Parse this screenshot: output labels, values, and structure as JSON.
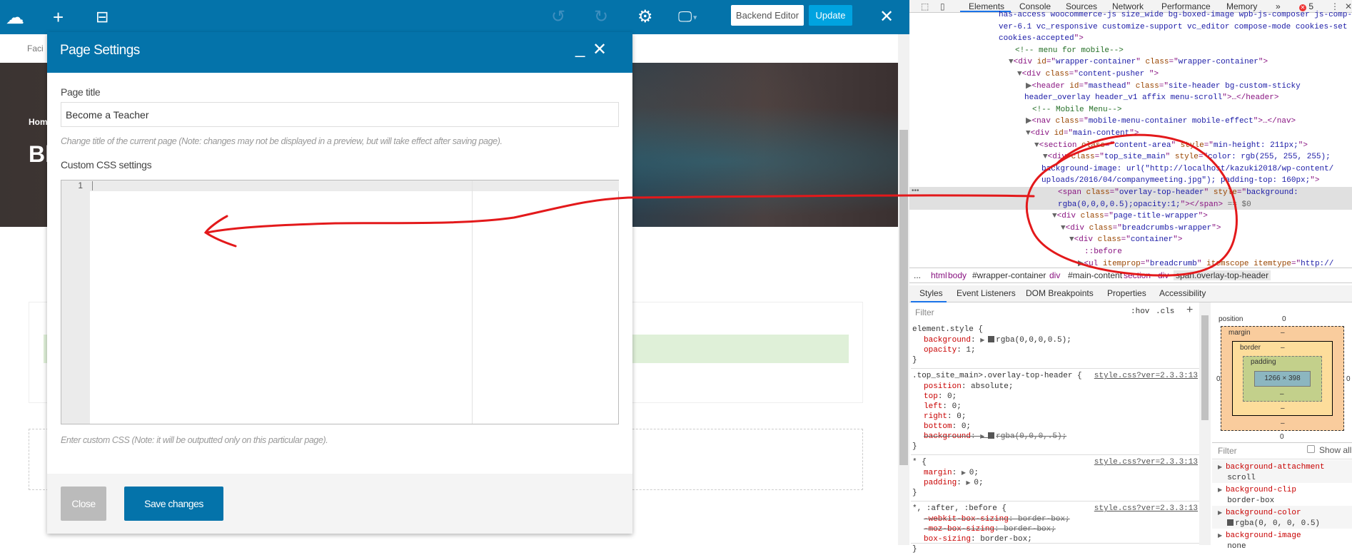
{
  "toolbar": {
    "icons": {
      "logo": "cloud-logo-icon",
      "add": "plus-icon",
      "templates": "layout-icon",
      "undo": "undo-icon",
      "redo": "redo-icon",
      "settings": "gear-icon",
      "responsive": "monitor-icon",
      "close": "close-icon"
    },
    "backend_editor": "Backend Editor",
    "update": "Update",
    "accent": "#0473aa",
    "update_color": "#00a3e0"
  },
  "page": {
    "subheader_text": "Faci",
    "breadcrumb_text": "Hom",
    "hero_title_text": "Bl"
  },
  "modal": {
    "title": "Page Settings",
    "minimize": "_",
    "close": "✕",
    "page_title_label": "Page title",
    "page_title_value": "Become a Teacher",
    "page_title_help": "Change title of the current page (Note: changes may not be displayed in a preview, but will take effect after saving page).",
    "css_label": "Custom CSS settings",
    "css_line_number": "1",
    "css_help": "Enter custom CSS (Note: it will be outputted only on this particular page).",
    "close_button": "Close",
    "save_button": "Save changes"
  },
  "devtools": {
    "tabs": [
      "Elements",
      "Console",
      "Sources",
      "Network",
      "Performance",
      "Memory",
      "»"
    ],
    "active_tab": "Elements",
    "error_count": "5",
    "dom_lines": [
      [
        [
          "v",
          "has-access woocommerce-js size_wide bg-boxed-image wpb-js-composer js-comp-"
        ]
      ],
      [
        [
          "v",
          "ver-6.1 vc_responsive customize-support vc_editor compose-mode cookies-set"
        ]
      ],
      [
        [
          "v",
          "cookies-accepted"
        ],
        [
          "t",
          "\">"
        ]
      ],
      [
        [
          "c",
          "<!-- menu for mobile-->"
        ]
      ],
      [
        [
          "g",
          "▼"
        ],
        [
          "t",
          "<div "
        ],
        [
          "a",
          "id"
        ],
        [
          "t",
          "=\""
        ],
        [
          "v",
          "wrapper-container"
        ],
        [
          "t",
          "\" "
        ],
        [
          "a",
          "class"
        ],
        [
          "t",
          "=\""
        ],
        [
          "v",
          "wrapper-container"
        ],
        [
          "t",
          "\">"
        ]
      ],
      [
        [
          "g",
          "▼"
        ],
        [
          "t",
          "<div "
        ],
        [
          "a",
          "class"
        ],
        [
          "t",
          "=\""
        ],
        [
          "v",
          "content-pusher "
        ],
        [
          "t",
          "\">"
        ]
      ],
      [
        [
          "g",
          "▶"
        ],
        [
          "t",
          "<header "
        ],
        [
          "a",
          "id"
        ],
        [
          "t",
          "=\""
        ],
        [
          "v",
          "masthead"
        ],
        [
          "t",
          "\" "
        ],
        [
          "a",
          "class"
        ],
        [
          "t",
          "=\""
        ],
        [
          "v",
          "site-header bg-custom-sticky"
        ]
      ],
      [
        [
          "v",
          "header_overlay header_v1 affix menu-scroll"
        ],
        [
          "t",
          "\">…</header>"
        ]
      ],
      [
        [
          "c",
          "<!-- Mobile Menu-->"
        ]
      ],
      [
        [
          "g",
          "▶"
        ],
        [
          "t",
          "<nav "
        ],
        [
          "a",
          "class"
        ],
        [
          "t",
          "=\""
        ],
        [
          "v",
          "mobile-menu-container mobile-effect"
        ],
        [
          "t",
          "\">…</nav>"
        ]
      ],
      [
        [
          "g",
          "▼"
        ],
        [
          "t",
          "<div "
        ],
        [
          "a",
          "id"
        ],
        [
          "t",
          "=\""
        ],
        [
          "v",
          "main-content"
        ],
        [
          "t",
          "\">"
        ]
      ],
      [
        [
          "g",
          "▼"
        ],
        [
          "t",
          "<section "
        ],
        [
          "a",
          "class"
        ],
        [
          "t",
          "=\""
        ],
        [
          "v",
          "content-area"
        ],
        [
          "t",
          "\" "
        ],
        [
          "a",
          "style"
        ],
        [
          "t",
          "=\""
        ],
        [
          "v",
          "min-height: 211px;"
        ],
        [
          "t",
          "\">"
        ]
      ],
      [
        [
          "g",
          "▼"
        ],
        [
          "t",
          "<div "
        ],
        [
          "a",
          "class"
        ],
        [
          "t",
          "=\""
        ],
        [
          "v",
          "top_site_main"
        ],
        [
          "t",
          "\" "
        ],
        [
          "a",
          "style"
        ],
        [
          "t",
          "=\""
        ],
        [
          "v",
          "color: rgb(255, 255, 255);"
        ]
      ],
      [
        [
          "v",
          "background-image: url(\"http://localhost/kazuki2018/wp-content/"
        ]
      ],
      [
        [
          "v",
          "uploads/2016/04/companymeeting.jpg\"); padding-top: 160px;"
        ],
        [
          "t",
          "\">"
        ]
      ],
      [
        [
          "t",
          "<span "
        ],
        [
          "a",
          "class"
        ],
        [
          "t",
          "=\""
        ],
        [
          "v",
          "overlay-top-header"
        ],
        [
          "t",
          "\" "
        ],
        [
          "a",
          "style"
        ],
        [
          "t",
          "=\""
        ],
        [
          "v",
          "background:"
        ]
      ],
      [
        [
          "v",
          "rgba(0,0,0,0.5);opacity:1;"
        ],
        [
          "t",
          "\"></span>"
        ],
        [
          "g",
          " == $0"
        ]
      ],
      [
        [
          "g",
          "▼"
        ],
        [
          "t",
          "<div "
        ],
        [
          "a",
          "class"
        ],
        [
          "t",
          "=\""
        ],
        [
          "v",
          "page-title-wrapper"
        ],
        [
          "t",
          "\">"
        ]
      ],
      [
        [
          "g",
          "▼"
        ],
        [
          "t",
          "<div "
        ],
        [
          "a",
          "class"
        ],
        [
          "t",
          "=\""
        ],
        [
          "v",
          "breadcrumbs-wrapper"
        ],
        [
          "t",
          "\">"
        ]
      ],
      [
        [
          "g",
          "▼"
        ],
        [
          "t",
          "<div "
        ],
        [
          "a",
          "class"
        ],
        [
          "t",
          "=\""
        ],
        [
          "v",
          "container"
        ],
        [
          "t",
          "\">"
        ]
      ],
      [
        [
          "t",
          "::before"
        ]
      ],
      [
        [
          "g",
          "▶"
        ],
        [
          "t",
          "<ul "
        ],
        [
          "a",
          "itemprop"
        ],
        [
          "t",
          "=\""
        ],
        [
          "v",
          "breadcrumb"
        ],
        [
          "t",
          "\" "
        ],
        [
          "a",
          "itemscope itemtype"
        ],
        [
          "t",
          "=\""
        ],
        [
          "v",
          "http://"
        ]
      ]
    ],
    "breadcrumbs": [
      "...",
      "html",
      "body",
      "#wrapper-container",
      "div",
      "#main-content",
      "section",
      "div",
      "span.overlay-top-header"
    ],
    "subtabs": [
      "Styles",
      "Event Listeners",
      "DOM Breakpoints",
      "Properties",
      "Accessibility"
    ],
    "filter_placeholder": "Filter",
    "hov": ":hov",
    "cls": ".cls",
    "add": "+",
    "rules": [
      {
        "selector": "element.style {",
        "source": "",
        "props": [
          {
            "name": "background",
            "value": "rgba(0,0,0,0.5);",
            "swatch": true,
            "struck": false
          },
          {
            "name": "opacity",
            "value": "1;",
            "swatch": false,
            "struck": false
          }
        ]
      },
      {
        "selector": ".top_site_main>.overlay-top-header {",
        "source": "style.css?ver=2.3.3:13",
        "props": [
          {
            "name": "position",
            "value": "absolute;",
            "struck": false
          },
          {
            "name": "top",
            "value": "0;",
            "struck": false
          },
          {
            "name": "left",
            "value": "0;",
            "struck": false
          },
          {
            "name": "right",
            "value": "0;",
            "struck": false
          },
          {
            "name": "bottom",
            "value": "0;",
            "struck": false
          },
          {
            "name": "background",
            "value": "rgba(0,0,0,.5);",
            "swatch": true,
            "struck": true
          }
        ]
      },
      {
        "selector": "* {",
        "source": "style.css?ver=2.3.3:13",
        "props": [
          {
            "name": "margin",
            "value": "0;",
            "expand": true,
            "struck": false
          },
          {
            "name": "padding",
            "value": "0;",
            "expand": true,
            "struck": false
          }
        ]
      },
      {
        "selector": "*, :after, :before {",
        "source": "style.css?ver=2.3.3:13",
        "props": [
          {
            "name": "-webkit-box-sizing",
            "value": "border-box;",
            "struck": true
          },
          {
            "name": "-moz-box-sizing",
            "value": "border-box;",
            "struck": true
          },
          {
            "name": "box-sizing",
            "value": "border-box;",
            "struck": false
          }
        ]
      }
    ],
    "box_model": {
      "position_label": "position",
      "position": "0",
      "margin_label": "margin",
      "border_label": "border",
      "padding_label": "padding",
      "dash": "–",
      "content": "1266 × 398",
      "left": "0",
      "right": "0",
      "bottom": "0"
    },
    "computed": {
      "filter_placeholder": "Filter",
      "show_all": "Show all",
      "show_all_checked": false,
      "props": [
        {
          "name": "background-attachment",
          "value": "scroll"
        },
        {
          "name": "background-clip",
          "value": "border-box"
        },
        {
          "name": "background-color",
          "value": "rgba(0, 0, 0, 0.5)",
          "swatch": true
        },
        {
          "name": "background-image",
          "value": "none"
        }
      ]
    }
  },
  "annotation": {
    "color": "#e3191b"
  }
}
